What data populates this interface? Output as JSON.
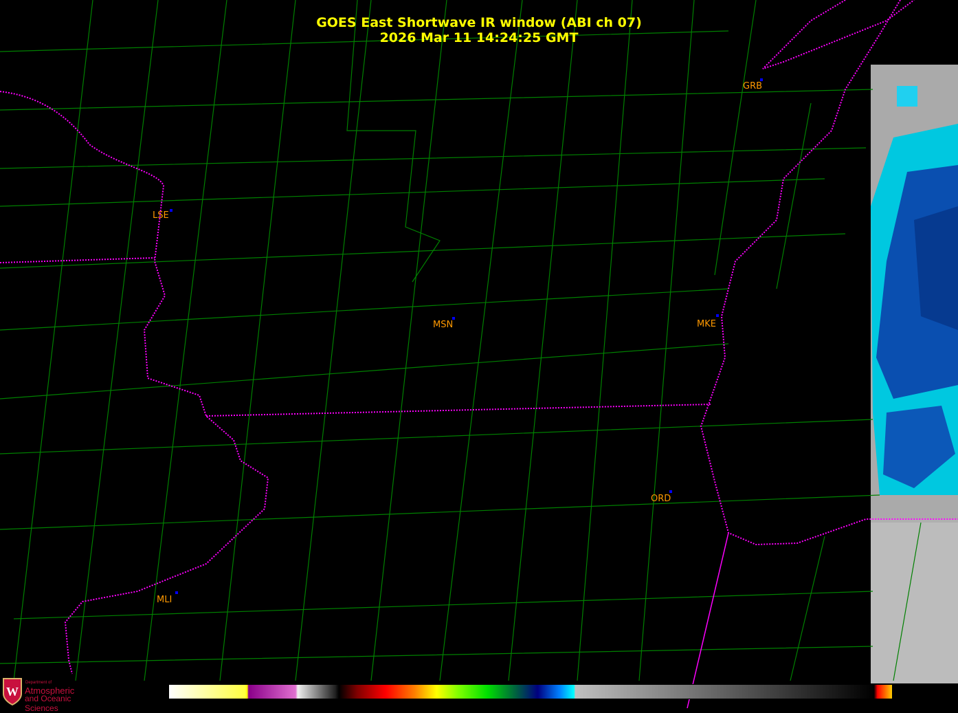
{
  "title": {
    "line1": "GOES East Shortwave IR window (ABI ch 07)",
    "line2": "2026 Mar 11  14:24:25 GMT"
  },
  "stations": [
    {
      "id": "GRB"
    },
    {
      "id": "LSE"
    },
    {
      "id": "MSN"
    },
    {
      "id": "MKE"
    },
    {
      "id": "ORD"
    },
    {
      "id": "MLI"
    }
  ],
  "logo": {
    "small": "Department of",
    "line1": "Atmospheric",
    "line2": "and Oceanic Sciences",
    "emblem": "W"
  },
  "colors": {
    "title": "#ffff00",
    "station_label": "#ff9900",
    "county_lines": "#008000",
    "state_borders": "#ff00ff"
  }
}
